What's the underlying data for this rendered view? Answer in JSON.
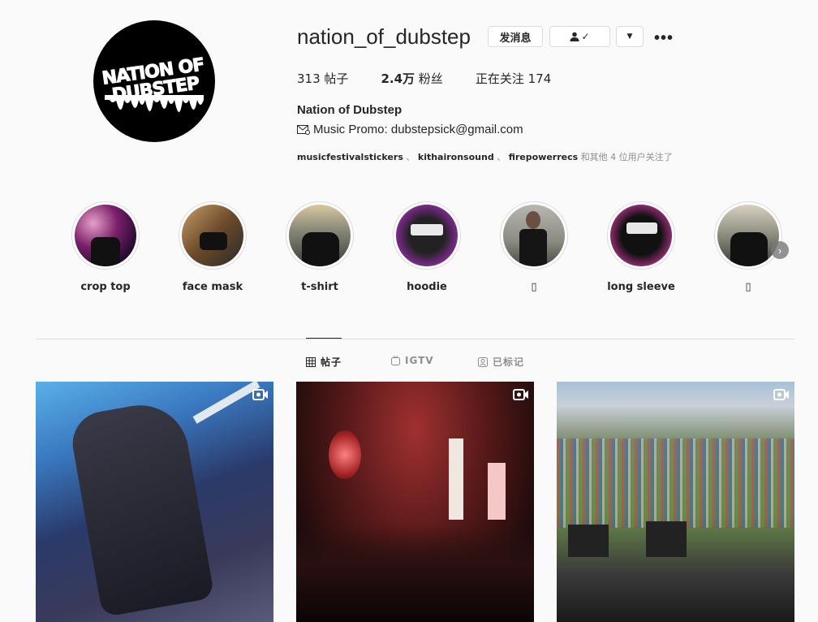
{
  "profile": {
    "username": "nation_of_dubstep",
    "logo_text": [
      "NATION OF",
      "DUBSTEP"
    ],
    "message_button": "发消息",
    "follow_button": "✓",
    "stats": {
      "posts_count": "313",
      "posts_label": "帖子",
      "followers_count": "2.4万",
      "followers_label": "粉丝",
      "following_label": "正在关注",
      "following_count": "174"
    },
    "full_name": "Nation of Dubstep",
    "promo_icon": "envelope-icon",
    "promo_text": "Music Promo: dubstepsick@gmail.com",
    "followed_by": {
      "user1": "musicfestivalstickers",
      "sep1": "、",
      "user2": "kithaironsound",
      "sep2": "、",
      "user3": "firepowerrecs",
      "suffix": "和其他 4 位用户关注了"
    }
  },
  "highlights": [
    {
      "label": "crop top"
    },
    {
      "label": "face mask"
    },
    {
      "label": "t-shirt"
    },
    {
      "label": "hoodie"
    },
    {
      "label": "▯"
    },
    {
      "label": "long sleeve"
    },
    {
      "label": "▯"
    }
  ],
  "tabs": {
    "posts": "帖子",
    "igtv": "IGTV",
    "tagged": "已标记"
  },
  "colors": {
    "background": "#fafafa",
    "border": "#dbdbdb",
    "text": "#262626",
    "muted": "#8e8e8e"
  }
}
